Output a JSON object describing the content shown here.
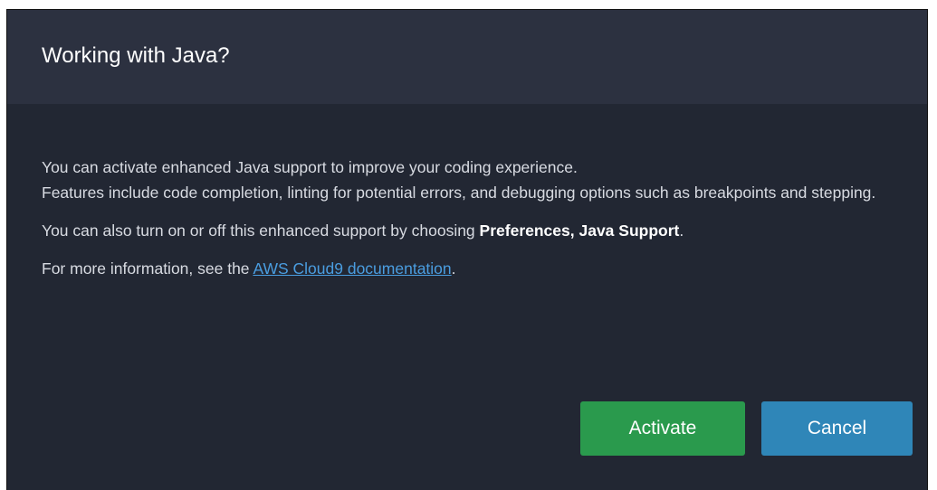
{
  "dialog": {
    "title": "Working with Java?",
    "body": {
      "line1": "You can activate enhanced Java support to improve your coding experience.",
      "line2": "Features include code completion, linting for potential errors, and debugging options such as breakpoints and stepping.",
      "para2_prefix": "You can also turn on or off this enhanced support by choosing ",
      "para2_strong": "Preferences, Java Support",
      "para2_suffix": ".",
      "para3_prefix": "For more information, see the ",
      "para3_link": "AWS Cloud9 documentation",
      "para3_suffix": "."
    },
    "buttons": {
      "activate": "Activate",
      "cancel": "Cancel"
    }
  },
  "colors": {
    "header_bg": "#2c3140",
    "body_bg": "#222733",
    "activate_bg": "#2a9a4d",
    "cancel_bg": "#2f86b8",
    "link": "#4a9de0"
  }
}
